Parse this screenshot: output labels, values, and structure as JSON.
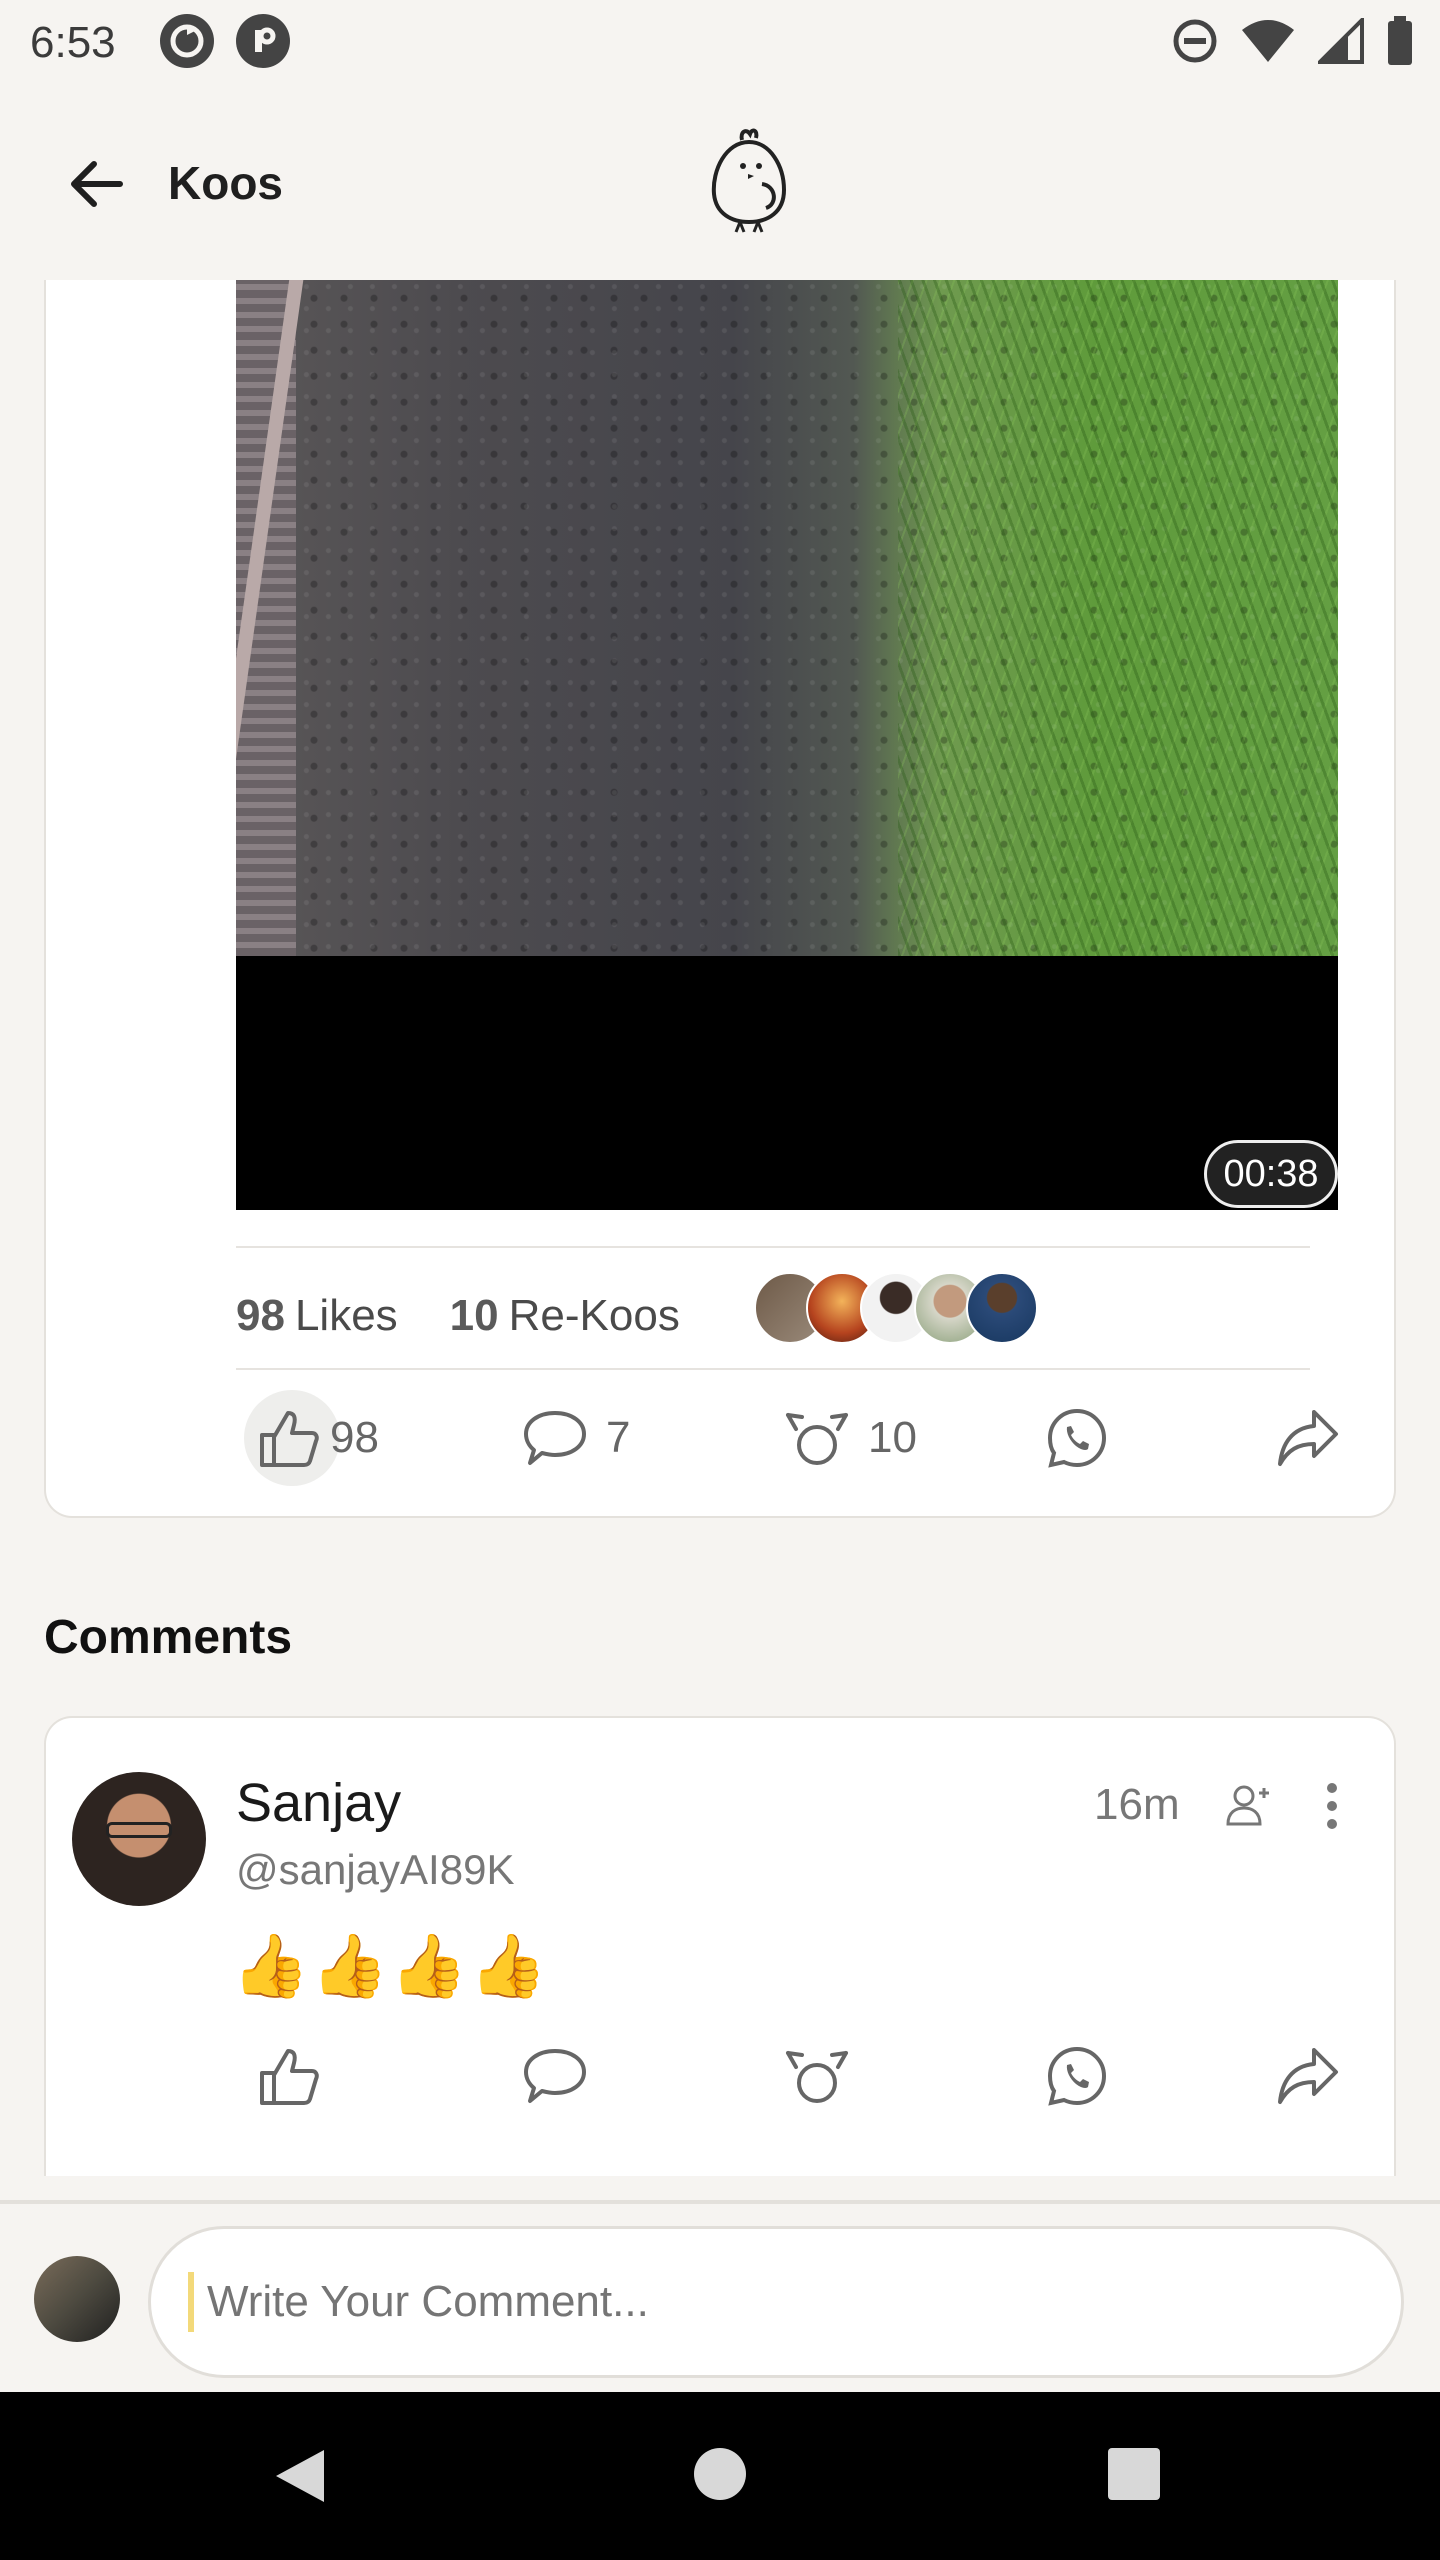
{
  "status_bar": {
    "time": "6:53",
    "app_icons": [
      "sync-icon",
      "r-icon"
    ],
    "right_icons": [
      "dnd-icon",
      "wifi-icon",
      "signal-icon",
      "battery-icon"
    ]
  },
  "app_bar": {
    "title": "Koos",
    "back_icon": "back-arrow-icon",
    "logo_icon": "koo-bird-icon"
  },
  "post": {
    "video_duration": "00:38",
    "likes_count": "98",
    "likes_label": "Likes",
    "rekoos_count": "10",
    "rekoos_label": "Re-Koos",
    "actions": {
      "like_count": "98",
      "comment_count": "7",
      "rekoo_count": "10"
    }
  },
  "comments": {
    "title": "Comments",
    "items": [
      {
        "name": "Sanjay",
        "handle": "@sanjayAI89K",
        "time": "16m",
        "body": "👍👍👍👍"
      }
    ]
  },
  "input": {
    "placeholder": "Write Your Comment..."
  },
  "colors": {
    "background": "#f6f4f1",
    "card": "#ffffff",
    "caret": "#f3d97a"
  }
}
